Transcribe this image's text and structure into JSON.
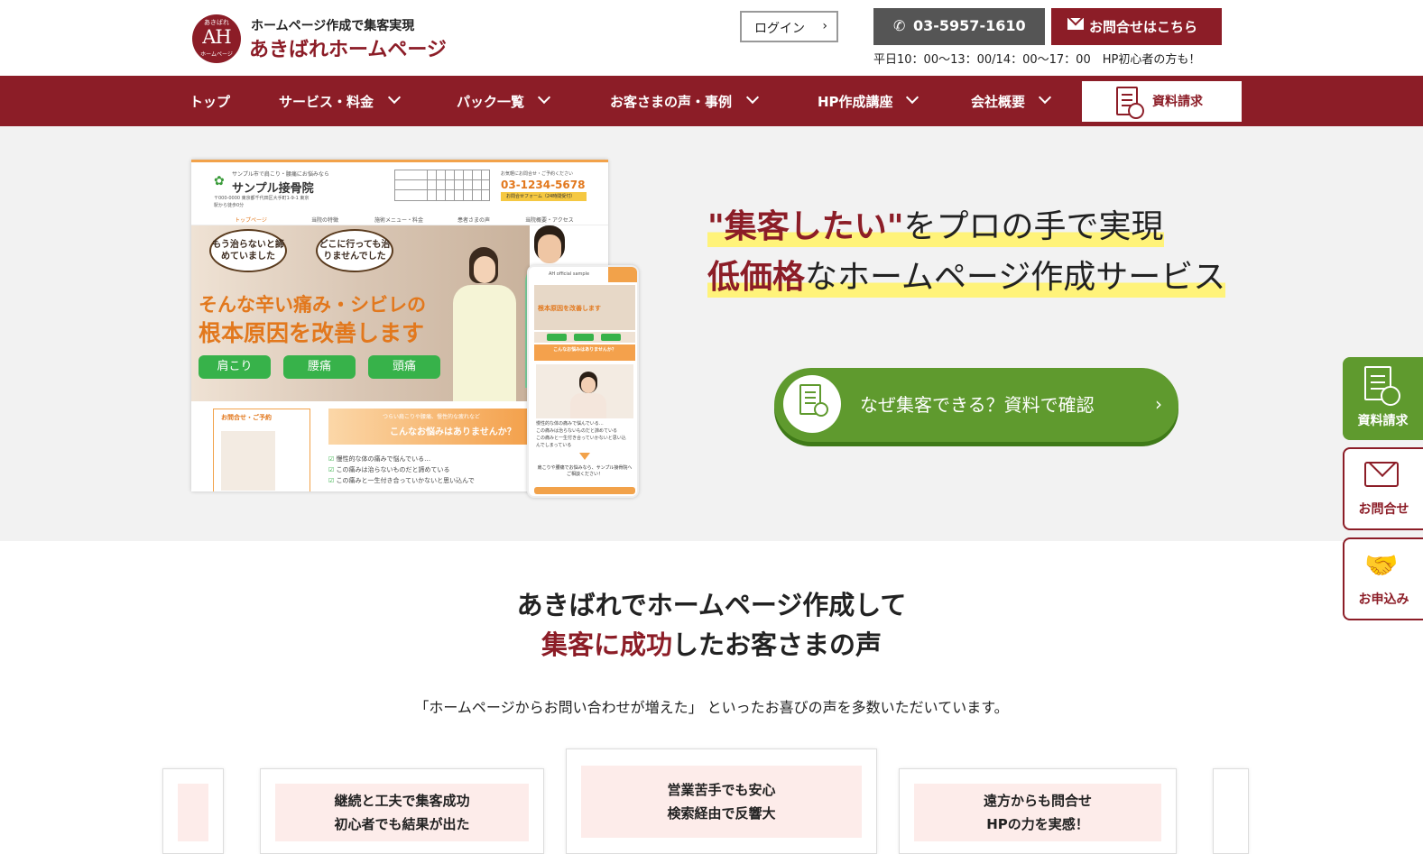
{
  "header": {
    "logo": {
      "top": "あきばれ",
      "main": "AH",
      "bottom": "ホームページ"
    },
    "tagline": "ホームページ作成で集客実現",
    "site_name": "あきばれホームページ",
    "login_label": "ログイン",
    "login_arrow": "›",
    "phone_icon": "phone-icon",
    "phone_number": "03-5957-1610",
    "contact_label": "お問合せはこちら",
    "hours": "平日10：00～13：00/14：00～17：00　HP初心者の方も！"
  },
  "nav": {
    "items": [
      {
        "label": "トップ"
      },
      {
        "label": "サービス・料金"
      },
      {
        "label": "パック一覧"
      },
      {
        "label": "お客さまの声・事例"
      },
      {
        "label": "HP作成講座"
      },
      {
        "label": "会社概要"
      }
    ],
    "doc_request_label": "資料請求"
  },
  "hero": {
    "mock": {
      "kicker": "サンプル市で肩こり・腰痛にお悩みなら",
      "clinic_name": "サンプル接骨院",
      "address": "〒000-0000 東京都千代田区大手町1-9-1 東京駅から徒歩0分",
      "phone_kicker": "お気軽にお問合せ・ご予約ください",
      "phone": "03-1234-5678",
      "form_label": "お問合せフォーム（24時間受付）",
      "nav": [
        "トップページ",
        "当院の特徴",
        "施術メニュー・料金",
        "患者さまの声",
        "当院概要・アクセス"
      ],
      "bubble1": "もう治らないと諦めていました",
      "bubble2": "どこに行っても治りませんでした",
      "catch1": "そんな辛い痛み・シビレの",
      "catch2": "根本原因を改善します",
      "tags": [
        "肩こり",
        "腰痛",
        "頭痛"
      ],
      "card_title": "お問合せ・ご予約",
      "worry_kicker": "つらい肩こりや腰痛、慢性的な疲れなど",
      "worry_title": "こんなお悩みはありませんか？",
      "checks": [
        "慢性的な体の痛みで悩んでいる…",
        "この痛みは治らないものだと諦めている",
        "この痛みと一生付き合っていかないと思い込んで"
      ],
      "phone_sample_title": "AH official sample",
      "phone_worry": "こんなお悩みはありませんか？",
      "phone_lines": [
        "慢性的な体の痛みで悩んでいる…",
        "この痛みは治らないものだと諦めている",
        "この痛みと一生付き合っていかないと思い込んでしまっている"
      ],
      "phone_foot": "肩こりや腰痛でお悩みなら、サンプル接骨院へご相談ください！"
    },
    "headline_quote": "\"集客したい\"",
    "headline_rest": "をプロの手で実現",
    "headline2_strong": "低価格",
    "headline2_rest": "なホームページ作成サービス",
    "cta_label": "なぜ集客できる？資料で確認",
    "cta_arrow": "›"
  },
  "side_tabs": {
    "doc": "資料請求",
    "contact": "お問合せ",
    "apply": "お申込み",
    "apply_icon": "🤝"
  },
  "reviews": {
    "title_line1": "あきばれでホームページ作成して",
    "title_accent": "集客に成功",
    "title_line2_rest": "したお客さまの声",
    "lead": "「ホームページからお問い合わせが増えた」 といったお喜びの声を多数いただいています。",
    "cards": [
      {
        "line1": "継続と工夫で集客成功",
        "line2": "初心者でも結果が出た"
      },
      {
        "line1": "営業苦手でも安心",
        "line2": "検索経由で反響大"
      },
      {
        "line1": "遠方からも問合せ",
        "line2": "HPの力を実感！"
      }
    ]
  }
}
